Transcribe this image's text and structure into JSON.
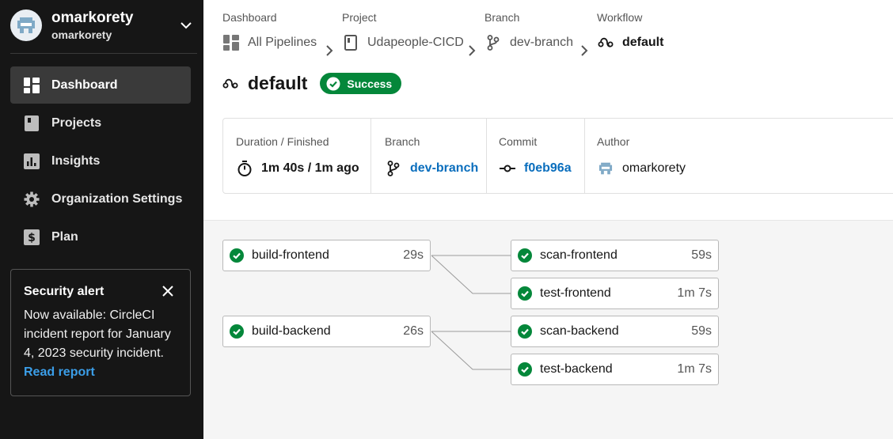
{
  "org": {
    "name": "omarkorety",
    "subtitle": "omarkorety"
  },
  "sidebar": {
    "items": [
      {
        "label": "Dashboard",
        "icon": "dashboard-icon",
        "active": true
      },
      {
        "label": "Projects",
        "icon": "projects-icon"
      },
      {
        "label": "Insights",
        "icon": "insights-icon"
      },
      {
        "label": "Organization Settings",
        "icon": "gear-icon"
      },
      {
        "label": "Plan",
        "icon": "dollar-icon"
      }
    ]
  },
  "alert": {
    "title": "Security alert",
    "body": "Now available: CircleCI incident report for January 4, 2023 security incident.",
    "link": "Read report"
  },
  "breadcrumb": {
    "dashboard": {
      "label": "Dashboard",
      "value": "All Pipelines"
    },
    "project": {
      "label": "Project",
      "value": "Udapeople-CICD"
    },
    "branch": {
      "label": "Branch",
      "value": "dev-branch"
    },
    "workflow": {
      "label": "Workflow",
      "value": "default"
    }
  },
  "page": {
    "title": "default",
    "status": "Success"
  },
  "meta": {
    "duration": {
      "label": "Duration / Finished",
      "value": "1m 40s / 1m ago"
    },
    "branch": {
      "label": "Branch",
      "value": "dev-branch"
    },
    "commit": {
      "label": "Commit",
      "value": "f0eb96a"
    },
    "author": {
      "label": "Author",
      "value": "omarkorety"
    }
  },
  "jobs": [
    {
      "name": "build-frontend",
      "duration": "29s"
    },
    {
      "name": "scan-frontend",
      "duration": "59s"
    },
    {
      "name": "test-frontend",
      "duration": "1m 7s"
    },
    {
      "name": "build-backend",
      "duration": "26s"
    },
    {
      "name": "scan-backend",
      "duration": "59s"
    },
    {
      "name": "test-backend",
      "duration": "1m 7s"
    }
  ],
  "colors": {
    "success": "#04873a",
    "link": "#0a6ebd",
    "sidebar": "#161616"
  }
}
